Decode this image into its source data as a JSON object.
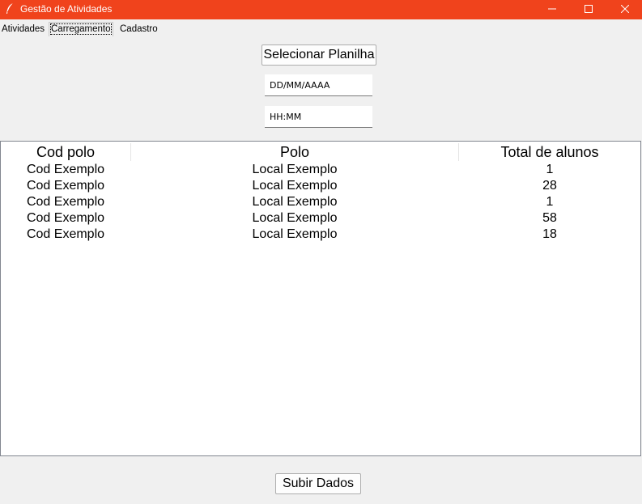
{
  "window": {
    "title": "Gestão de Atividades",
    "accent_color": "#f0431c",
    "controls": [
      "minimize-icon",
      "maximize-icon",
      "close-icon"
    ]
  },
  "tabs": [
    {
      "label": "Atividades",
      "active": false
    },
    {
      "label": "Carregamento",
      "active": true
    },
    {
      "label": "Cadastro",
      "active": false
    }
  ],
  "upload": {
    "select_button": "Selecionar Planilha",
    "date_field": {
      "value": "DD/MM/AAAA"
    },
    "time_field": {
      "value": "HH:MM"
    }
  },
  "table": {
    "columns": [
      "Cod polo",
      "Polo",
      "Total de alunos"
    ],
    "rows": [
      [
        "Cod Exemplo",
        "Local Exemplo",
        "1"
      ],
      [
        "Cod Exemplo",
        "Local Exemplo",
        "28"
      ],
      [
        "Cod Exemplo",
        "Local Exemplo",
        "1"
      ],
      [
        "Cod Exemplo",
        "Local Exemplo",
        "58"
      ],
      [
        "Cod Exemplo",
        "Local Exemplo",
        "18"
      ]
    ]
  },
  "footer": {
    "submit_button": "Subir Dados"
  }
}
